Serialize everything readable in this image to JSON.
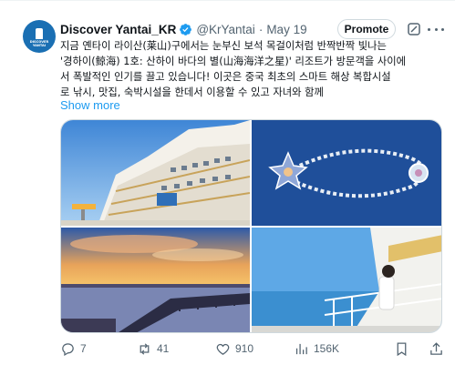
{
  "author": {
    "name": "Discover Yantai_KR",
    "handle": "@KrYantai",
    "separator": "·",
    "time": "May 19",
    "avatar_text": "DISCOVER\nYANTAI",
    "verified_color": "#1d9bf0"
  },
  "header_actions": {
    "promote_label": "Promote",
    "grok_icon": "grok-icon",
    "more_icon": "more-dots-icon"
  },
  "tweet": {
    "lines": [
      "지금 옌타이 라이산(莱山)구에서는 눈부신 보석 목걸이처럼 반짝반짝 빛나는",
      "'경하이(鲸海) 1호: 산하이 바다의 별(山海海洋之星)' 리조트가 방문객을 사이에",
      "서 폭발적인 인기를 끌고 있습니다! 이곳은 중국 최초의 스마트 해상 복합시설",
      "로 낚시, 맛집, 숙박시설을 한데서 이용할 수 있고 자녀와 함께"
    ],
    "show_more": "Show more"
  },
  "media": [
    {
      "name": "cruise-ship-photo"
    },
    {
      "name": "necklace-platform-aerial-photo"
    },
    {
      "name": "sunset-pier-photo"
    },
    {
      "name": "ship-deck-woman-photo"
    }
  ],
  "actions": {
    "replies": "7",
    "retweets": "41",
    "likes": "910",
    "views": "156K",
    "bookmark_icon": "bookmark-icon",
    "share_icon": "share-icon"
  },
  "colors": {
    "accent": "#1d9bf0",
    "text": "#0f1419",
    "secondary": "#536471",
    "border": "#cfd9de"
  }
}
